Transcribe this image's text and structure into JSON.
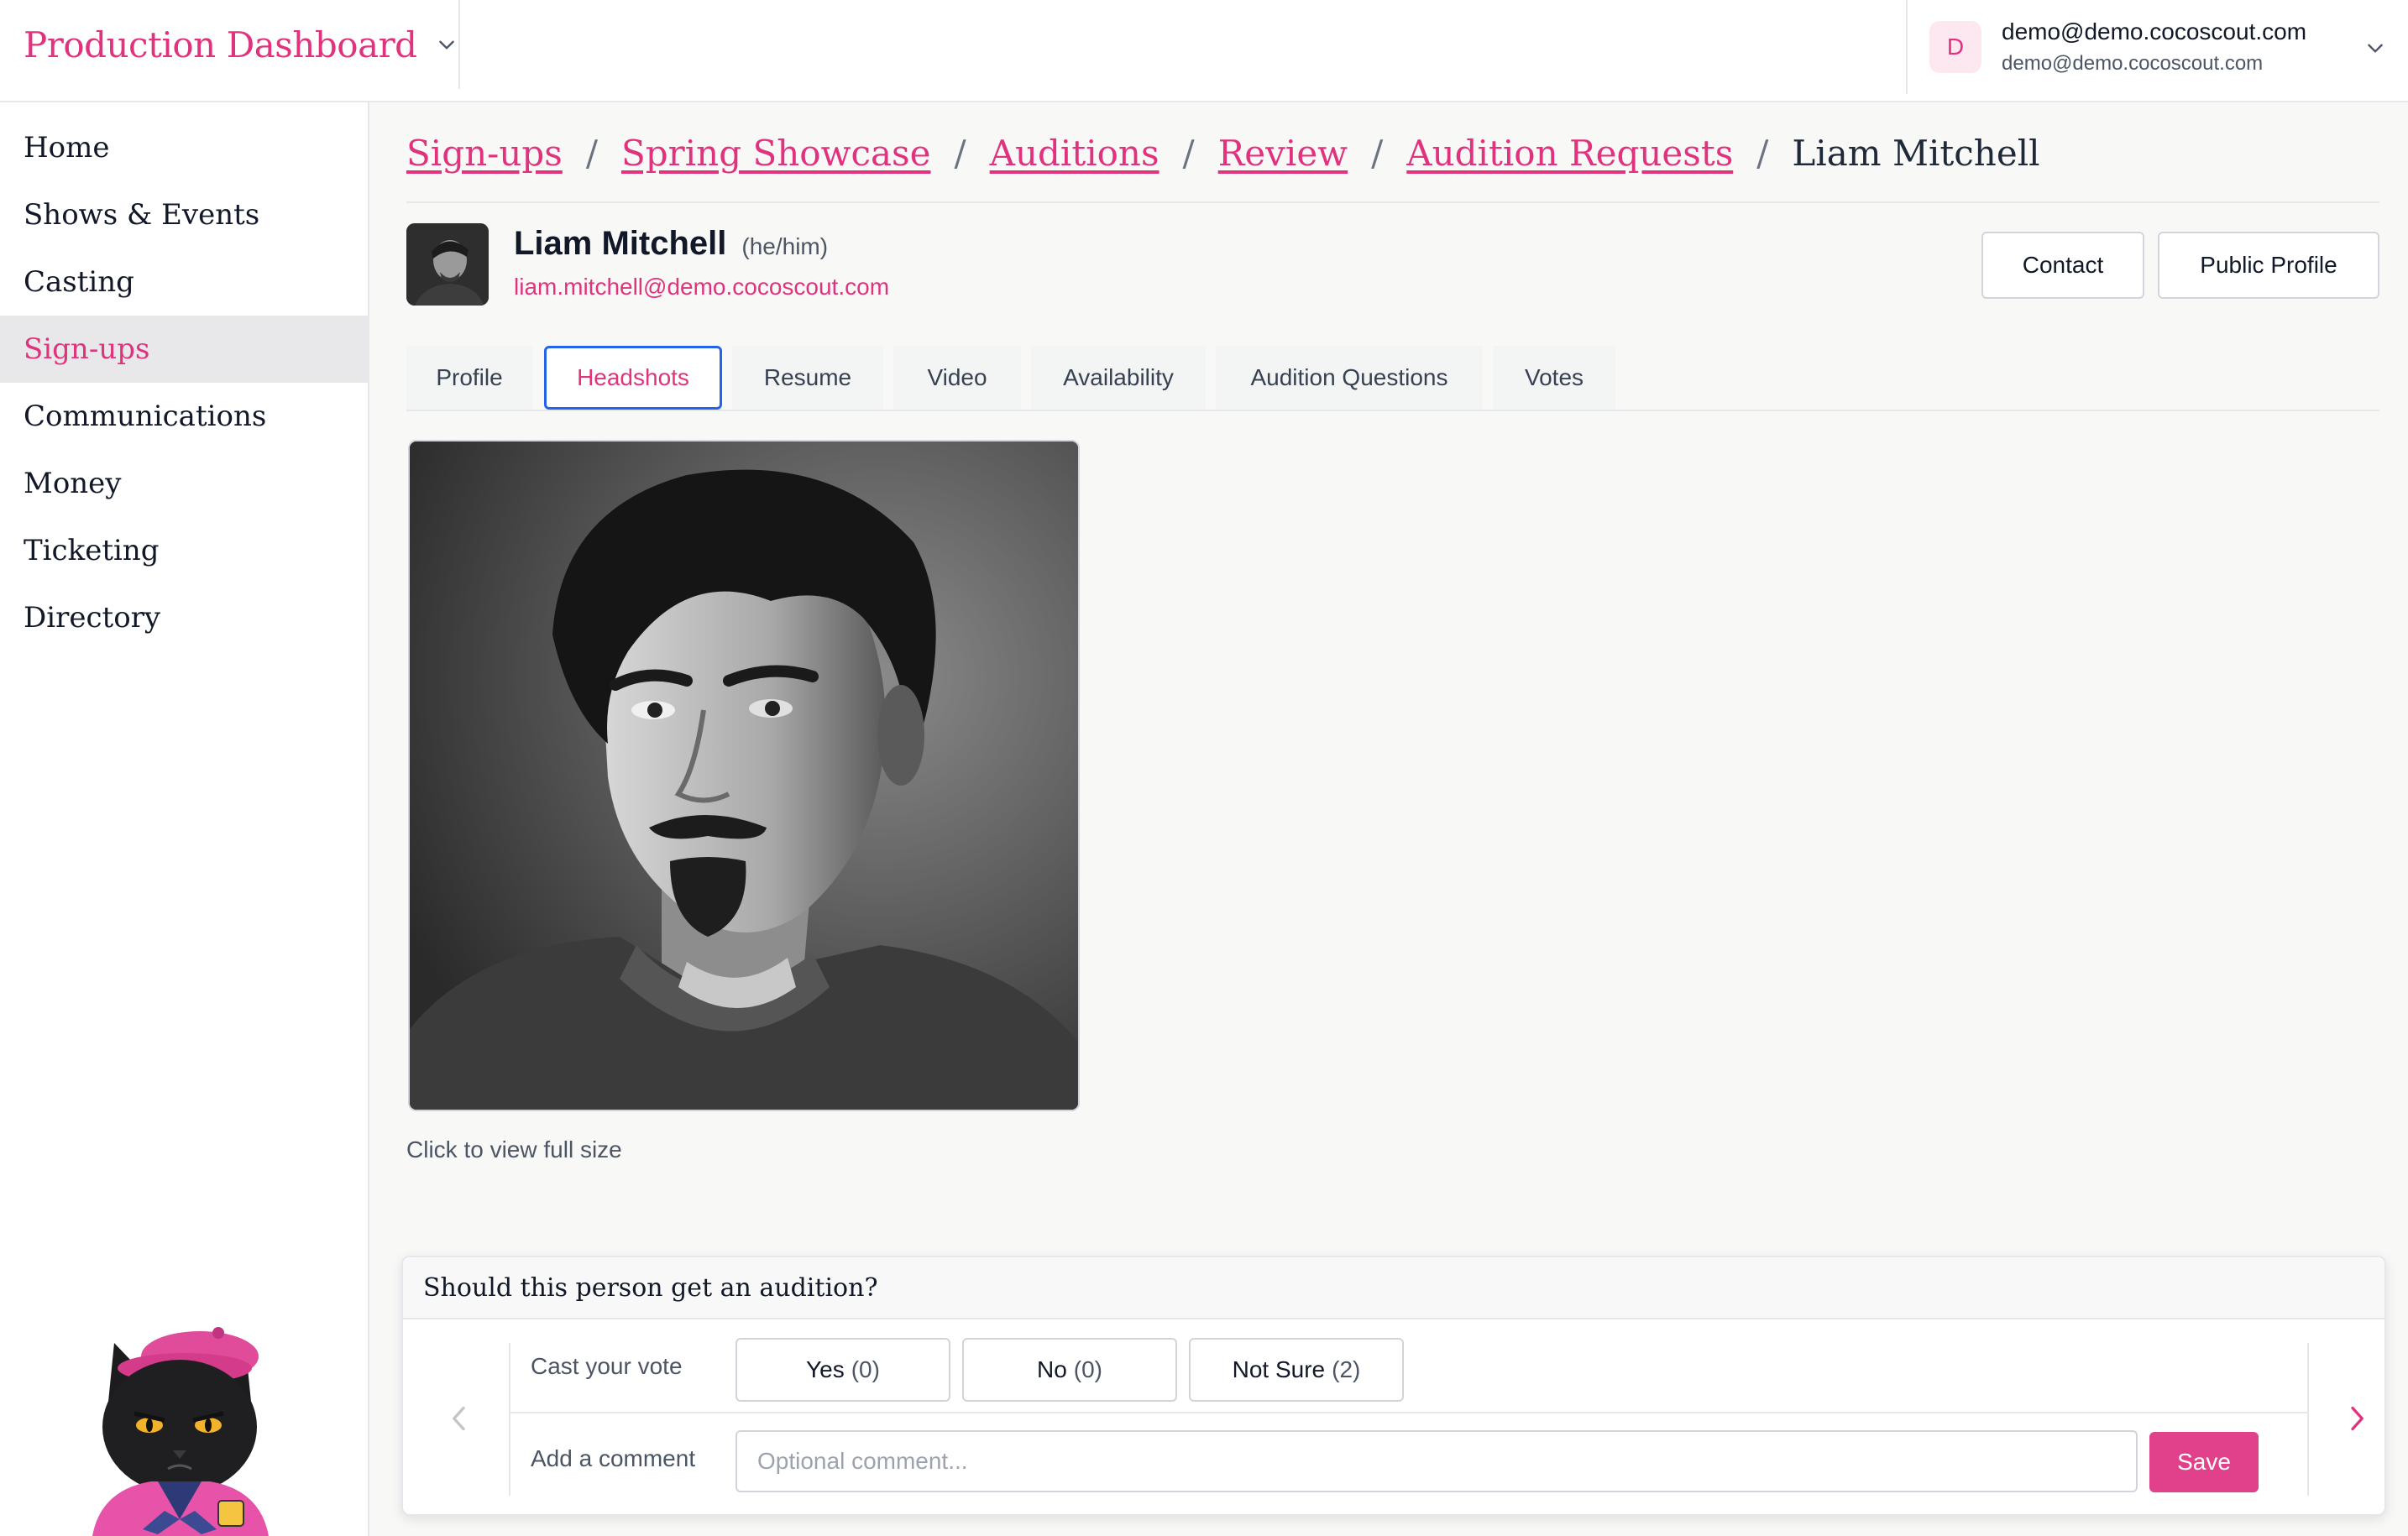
{
  "header": {
    "production_title": "Production Dashboard",
    "user_initial": "D",
    "user_email": "demo@demo.cocoscout.com",
    "user_sub": "demo@demo.cocoscout.com"
  },
  "sidebar": {
    "items": [
      {
        "label": "Home"
      },
      {
        "label": "Shows & Events"
      },
      {
        "label": "Casting"
      },
      {
        "label": "Sign-ups",
        "active": true
      },
      {
        "label": "Communications"
      },
      {
        "label": "Money"
      },
      {
        "label": "Ticketing"
      },
      {
        "label": "Directory"
      }
    ]
  },
  "breadcrumb": {
    "items": [
      "Sign-ups",
      "Spring Showcase",
      "Auditions",
      "Review",
      "Audition Requests"
    ],
    "separator": "/",
    "current": "Liam Mitchell"
  },
  "person": {
    "name": "Liam Mitchell",
    "pronouns": "(he/him)",
    "email": "liam.mitchell@demo.cocoscout.com"
  },
  "actions": {
    "contact": "Contact",
    "public_profile": "Public Profile"
  },
  "tabs": [
    {
      "label": "Profile"
    },
    {
      "label": "Headshots",
      "active": true
    },
    {
      "label": "Resume"
    },
    {
      "label": "Video"
    },
    {
      "label": "Availability"
    },
    {
      "label": "Audition Questions"
    },
    {
      "label": "Votes"
    }
  ],
  "headshot": {
    "caption": "Click to view full size"
  },
  "vote": {
    "question": "Should this person get an audition?",
    "cast_label": "Cast your vote",
    "yes_label": "Yes",
    "yes_count": "(0)",
    "no_label": "No",
    "no_count": "(0)",
    "notsure_label": "Not Sure",
    "notsure_count": "(2)",
    "comment_label": "Add a comment",
    "comment_placeholder": "Optional comment...",
    "save_label": "Save"
  },
  "colors": {
    "accent": "#e0337e",
    "focus_ring": "#2563eb",
    "save_bg": "#e0418a"
  }
}
